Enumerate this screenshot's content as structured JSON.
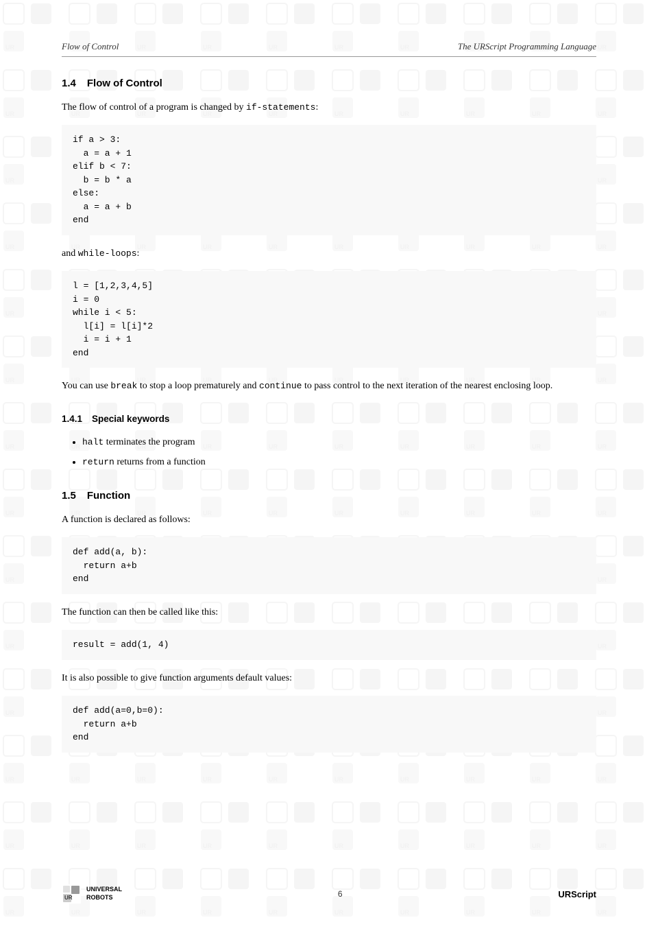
{
  "header": {
    "left": "Flow of Control",
    "right": "The URScript Programming Language"
  },
  "section_14": {
    "number": "1.4",
    "title": "Flow of Control",
    "intro": "The flow of control of a program is changed by",
    "intro_code": "if-statements",
    "intro_suffix": ":",
    "code_block_1": "if a > 3:\n  a = a + 1\nelif b < 7:\n  b = b * a\nelse:\n  a = a + b\nend",
    "and_text": "and",
    "while_code": "while-loops",
    "code_block_2": "l = [1,2,3,4,5]\ni = 0\nwhile i < 5:\n  l[i] = l[i]*2\n  i = i + 1\nend",
    "break_text_before": "You can use",
    "break_code": "break",
    "break_text_middle": "to stop a loop prematurely and",
    "continue_code": "continue",
    "break_text_after": "to pass control to the next iteration of the nearest enclosing loop."
  },
  "section_141": {
    "number": "1.4.1",
    "title": "Special keywords",
    "items": [
      {
        "code": "halt",
        "text": "terminates the program"
      },
      {
        "code": "return",
        "text": "returns from a function"
      }
    ]
  },
  "section_15": {
    "number": "1.5",
    "title": "Function",
    "intro": "A function is declared as follows:",
    "code_block_1": "def add(a, b):\n  return a+b\nend",
    "then_text": "The function can then be called like this:",
    "code_block_2": "result = add(1, 4)",
    "default_text": "It is also possible to give function arguments default values:",
    "code_block_3": "def add(a=0,b=0):\n  return a+b\nend"
  },
  "footer": {
    "logo_line1": "UNIVERSAL",
    "logo_line2": "ROBOTS",
    "page_number": "6",
    "script_name": "URScript"
  }
}
